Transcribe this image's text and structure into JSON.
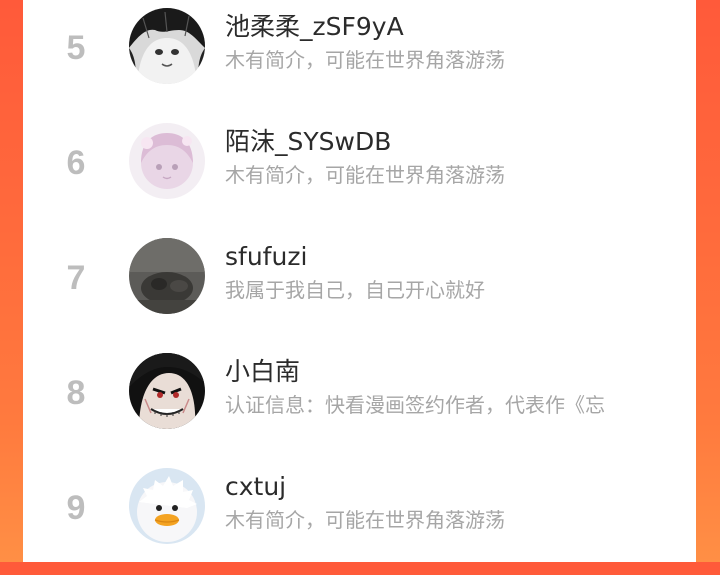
{
  "leaderboard": {
    "entries": [
      {
        "rank": "5",
        "name": "池柔柔_zSF9yA",
        "bio": "木有简介，可能在世界角落游荡",
        "avatar_icon": "anime-girl-grayscale-avatar"
      },
      {
        "rank": "6",
        "name": "陌沫_SYSwDB",
        "bio": "木有简介，可能在世界角落游荡",
        "avatar_icon": "pastel-anime-avatar"
      },
      {
        "rank": "7",
        "name": "sfufuzi",
        "bio": "我属于我自己，自己开心就好",
        "avatar_icon": "dark-photo-avatar"
      },
      {
        "rank": "8",
        "name": "小白南",
        "bio": "认证信息：快看漫画签约作者，代表作《忘",
        "avatar_icon": "grinning-character-avatar"
      },
      {
        "rank": "9",
        "name": "cxtuj",
        "bio": "木有简介，可能在世界角落游荡",
        "avatar_icon": "fluffy-duck-avatar"
      }
    ]
  },
  "colors": {
    "background_gradient_top": "#ff5a3a",
    "background_gradient_bottom": "#ff8f45",
    "rank_color": "#bdbdbd",
    "name_color": "#2b2b2b",
    "bio_color": "#a6a6a6"
  }
}
